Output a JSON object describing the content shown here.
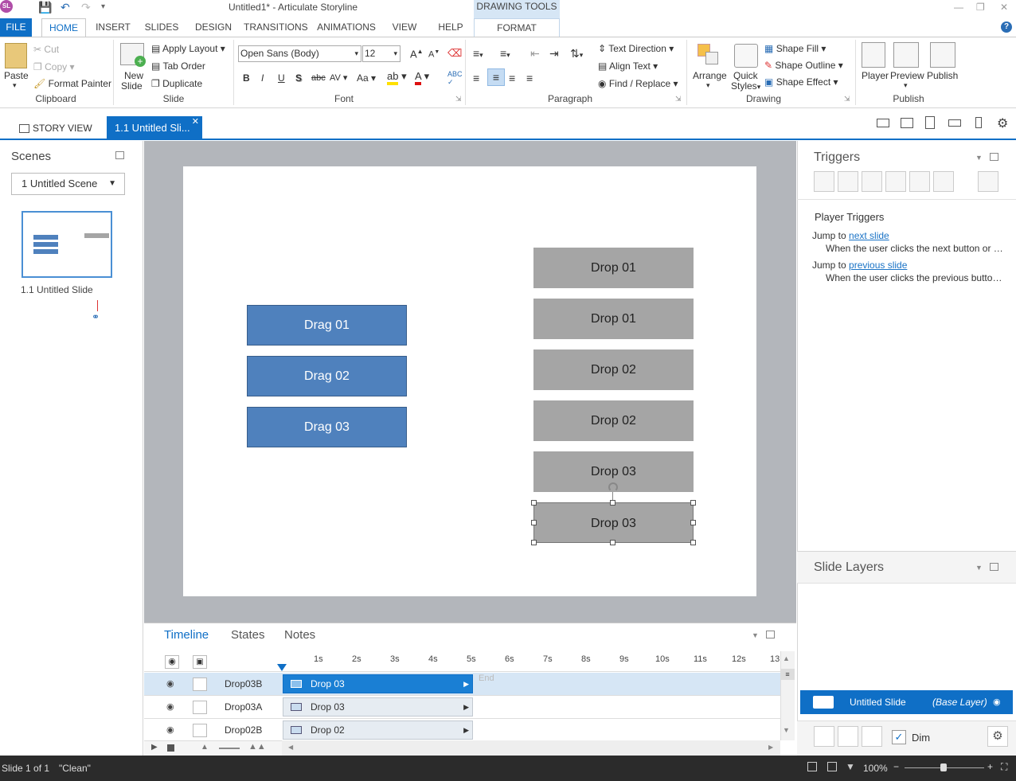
{
  "app": {
    "title": "Untitled1* -  Articulate Storyline",
    "logo": "SL",
    "contextual_tab_group": "DRAWING TOOLS"
  },
  "ribbon_tabs": [
    "FILE",
    "HOME",
    "INSERT",
    "SLIDES",
    "DESIGN",
    "TRANSITIONS",
    "ANIMATIONS",
    "VIEW",
    "HELP",
    "FORMAT"
  ],
  "clipboard": {
    "paste": "Paste",
    "cut": "Cut",
    "copy": "Copy",
    "format_painter": "Format Painter",
    "label": "Clipboard"
  },
  "slide_group": {
    "new_slide": "New",
    "new_slide2": "Slide",
    "apply_layout": "Apply Layout",
    "tab_order": "Tab Order",
    "duplicate": "Duplicate",
    "label": "Slide"
  },
  "font": {
    "family": "Open Sans (Body)",
    "size": "12",
    "label": "Font",
    "bold": "B",
    "italic": "I",
    "underline": "U",
    "shadow": "S",
    "strike": "abc",
    "spacing": "AV",
    "case": "Aa"
  },
  "paragraph": {
    "text_direction": "Text Direction",
    "align_text": "Align Text",
    "find_replace": "Find / Replace",
    "label": "Paragraph"
  },
  "drawing": {
    "arrange": "Arrange",
    "quick_styles": "Quick",
    "quick_styles2": "Styles",
    "shape_fill": "Shape Fill",
    "shape_outline": "Shape Outline",
    "shape_effect": "Shape Effect",
    "label": "Drawing"
  },
  "publish": {
    "player": "Player",
    "preview": "Preview",
    "publish": "Publish",
    "label": "Publish"
  },
  "doc_tabs": {
    "story_view": "STORY VIEW",
    "slide_tab": "1.1 Untitled Sli..."
  },
  "scenes": {
    "title": "Scenes",
    "selected_scene": "1 Untitled Scene",
    "thumb_label": "1.1 Untitled Slide"
  },
  "slide_objects": {
    "drags": [
      "Drag 01",
      "Drag 02",
      "Drag 03"
    ],
    "drops": [
      "Drop 01",
      "Drop 01",
      "Drop 02",
      "Drop 02",
      "Drop 03",
      "Drop 03"
    ]
  },
  "timeline": {
    "tabs": [
      "Timeline",
      "States",
      "Notes"
    ],
    "ticks": [
      "1s",
      "2s",
      "3s",
      "4s",
      "5s",
      "6s",
      "7s",
      "8s",
      "9s",
      "10s",
      "11s",
      "12s",
      "13"
    ],
    "end_label": "End",
    "rows": [
      {
        "name": "Drop03B",
        "bar": "Drop 03"
      },
      {
        "name": "Drop03A",
        "bar": "Drop 03"
      },
      {
        "name": "Drop02B",
        "bar": "Drop 02"
      }
    ]
  },
  "triggers": {
    "title": "Triggers",
    "section": "Player Triggers",
    "items": [
      {
        "prefix": "Jump to ",
        "link": "next slide",
        "desc": "When the user clicks the next button or s..."
      },
      {
        "prefix": "Jump to ",
        "link": "previous slide",
        "desc": "When the user clicks the previous button..."
      }
    ]
  },
  "layers": {
    "title": "Slide Layers",
    "base_name": "Untitled Slide",
    "base_tag": "(Base Layer)",
    "dim": "Dim"
  },
  "status": {
    "slide": "Slide 1 of 1",
    "theme": "\"Clean\"",
    "zoom": "100%"
  },
  "colors": {
    "accent": "#0f6fc6",
    "drag_fill": "#4f81bd",
    "drop_fill": "#a5a5a5"
  }
}
